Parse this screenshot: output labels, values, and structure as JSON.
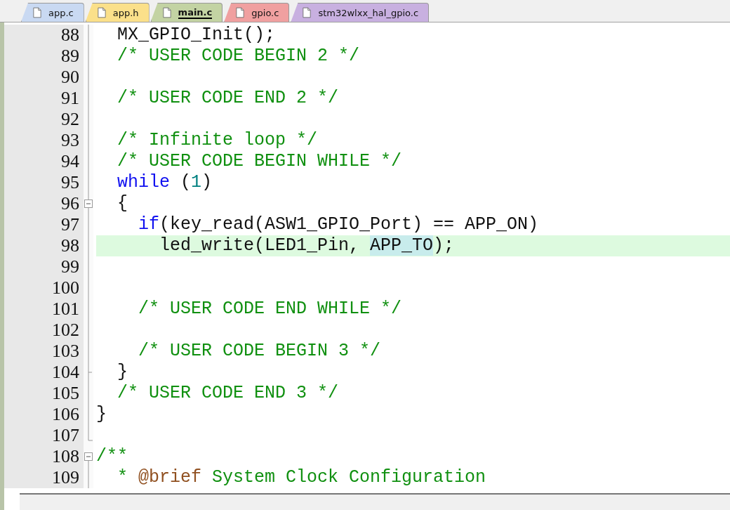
{
  "tabs": [
    {
      "label": "app.c",
      "color": "#c9d9f2",
      "selected": false
    },
    {
      "label": "app.h",
      "color": "#fbe08a",
      "selected": false
    },
    {
      "label": "main.c",
      "color": "#c3d3a3",
      "selected": true
    },
    {
      "label": "gpio.c",
      "color": "#f0a0a0",
      "selected": false
    },
    {
      "label": "stm32wlxx_hal_gpio.c",
      "color": "#c8b0e0",
      "selected": false
    }
  ],
  "lines": [
    {
      "number": "88",
      "kind": "fold_line",
      "current": false,
      "tokens": [
        {
          "kind": "plain",
          "text": "  MX_GPIO_Init();"
        }
      ]
    },
    {
      "number": "89",
      "kind": "fold_line",
      "current": false,
      "tokens": [
        {
          "kind": "comment",
          "text": "  /* USER CODE BEGIN 2 */"
        }
      ]
    },
    {
      "number": "90",
      "kind": "fold_line",
      "current": false
    },
    {
      "number": "91",
      "kind": "fold_line",
      "current": false,
      "tokens": [
        {
          "kind": "comment",
          "text": "  /* USER CODE END 2 */"
        }
      ]
    },
    {
      "number": "92",
      "kind": "fold_line",
      "current": false
    },
    {
      "number": "93",
      "kind": "fold_line",
      "current": false,
      "tokens": [
        {
          "kind": "comment",
          "text": "  /* Infinite loop */"
        }
      ]
    },
    {
      "number": "94",
      "kind": "fold_line",
      "current": false,
      "tokens": [
        {
          "kind": "comment",
          "text": "  /* USER CODE BEGIN WHILE */"
        }
      ]
    },
    {
      "number": "95",
      "kind": "fold_line",
      "current": false,
      "tokens": [
        {
          "kind": "keyword",
          "text": "  while"
        },
        {
          "kind": "plain",
          "text": " ("
        },
        {
          "kind": "number",
          "text": "1"
        },
        {
          "kind": "plain",
          "text": ")"
        }
      ]
    },
    {
      "number": "96",
      "kind": "fold_open",
      "current": false,
      "tokens": [
        {
          "kind": "plain",
          "text": "  {"
        }
      ]
    },
    {
      "number": "97",
      "kind": "fold_line",
      "current": false,
      "tokens": [
        {
          "kind": "keyword",
          "text": "    if"
        },
        {
          "kind": "plain",
          "text": "(key_read(ASW1_GPIO_Port) == APP_ON)"
        }
      ]
    },
    {
      "number": "98",
      "kind": "fold_line",
      "current": true,
      "tokens": [
        {
          "kind": "plain",
          "text": "      led_write(LED1_Pin, "
        },
        {
          "kind": "match",
          "text": "APP_TO"
        },
        {
          "kind": "plain",
          "text": ");"
        }
      ]
    },
    {
      "number": "99",
      "kind": "fold_line",
      "current": false
    },
    {
      "number": "100",
      "kind": "fold_line",
      "current": false
    },
    {
      "number": "101",
      "kind": "fold_line",
      "current": false,
      "tokens": [
        {
          "kind": "comment",
          "text": "    /* USER CODE END WHILE */"
        }
      ]
    },
    {
      "number": "102",
      "kind": "fold_line",
      "current": false
    },
    {
      "number": "103",
      "kind": "fold_line",
      "current": false,
      "tokens": [
        {
          "kind": "comment",
          "text": "    /* USER CODE BEGIN 3 */"
        }
      ]
    },
    {
      "number": "104",
      "kind": "fold_branch",
      "current": false,
      "tokens": [
        {
          "kind": "plain",
          "text": "  }"
        }
      ]
    },
    {
      "number": "105",
      "kind": "fold_line",
      "current": false,
      "tokens": [
        {
          "kind": "comment",
          "text": "  /* USER CODE END 3 */"
        }
      ]
    },
    {
      "number": "106",
      "kind": "fold_line",
      "current": false,
      "tokens": [
        {
          "kind": "plain",
          "text": "}"
        }
      ]
    },
    {
      "number": "107",
      "kind": "fold_end",
      "current": false
    },
    {
      "number": "108",
      "kind": "fold_start",
      "current": false,
      "tokens": [
        {
          "kind": "comment",
          "text": "/**"
        }
      ]
    },
    {
      "number": "109",
      "kind": "fold_line",
      "current": false,
      "tokens": [
        {
          "kind": "comment",
          "text": "  * "
        },
        {
          "kind": "doctag",
          "text": "@brief"
        },
        {
          "kind": "comment",
          "text": " System Clock Configuration"
        }
      ]
    }
  ]
}
